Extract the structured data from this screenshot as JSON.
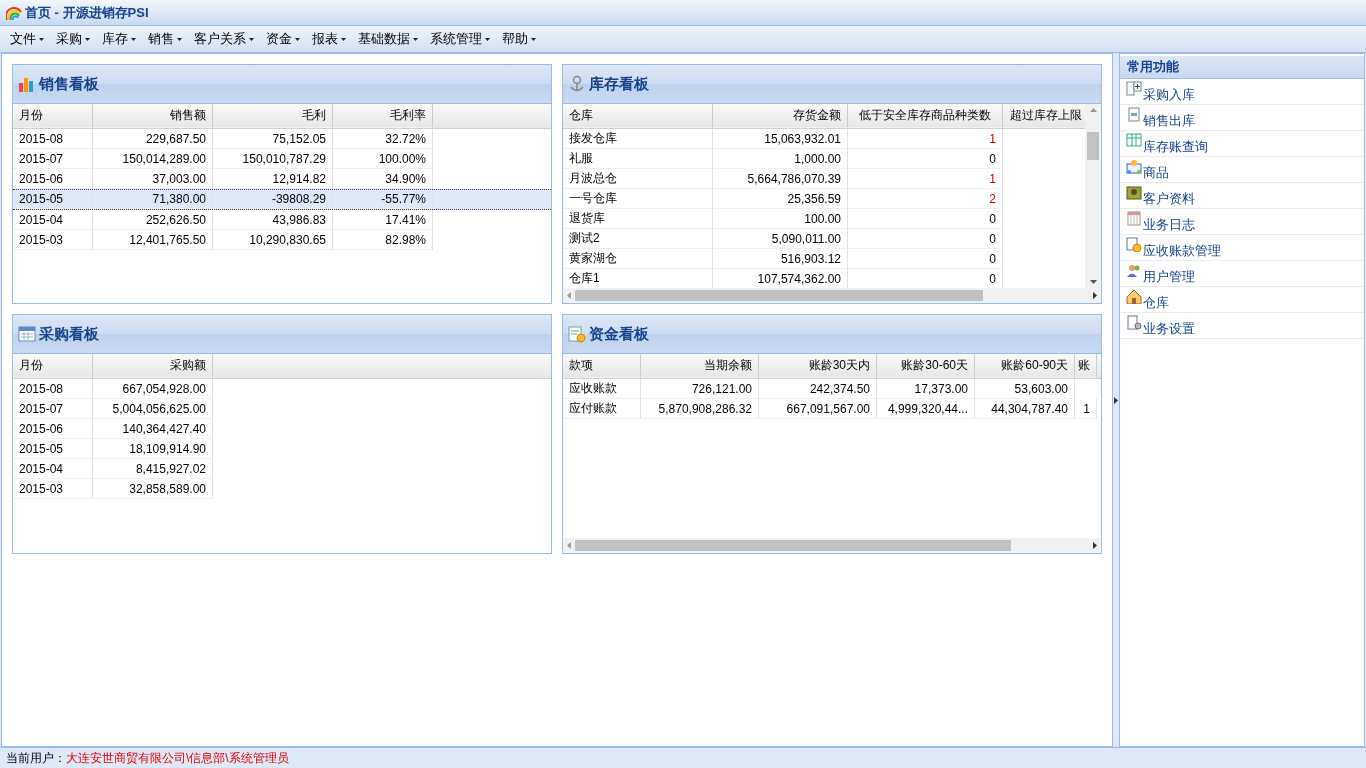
{
  "window": {
    "title": "首页 - 开源进销存PSI"
  },
  "menu": [
    "文件",
    "采购",
    "库存",
    "销售",
    "客户关系",
    "资金",
    "报表",
    "基础数据",
    "系统管理",
    "帮助"
  ],
  "panels": [
    {
      "title": "销售看板",
      "columns": [
        "月份",
        "销售额",
        "毛利",
        "毛利率"
      ],
      "rows": [
        {
          "cells": [
            "2015-08",
            "229,687.50",
            "75,152.05",
            "32.72%"
          ],
          "selected": false
        },
        {
          "cells": [
            "2015-07",
            "150,014,289.00",
            "150,010,787.29",
            "100.00%"
          ],
          "selected": false
        },
        {
          "cells": [
            "2015-06",
            "37,003.00",
            "12,914.82",
            "34.90%"
          ],
          "selected": false
        },
        {
          "cells": [
            "2015-05",
            "71,380.00",
            "-39808.29",
            "-55.77%"
          ],
          "selected": true
        },
        {
          "cells": [
            "2015-04",
            "252,626.50",
            "43,986.83",
            "17.41%"
          ],
          "selected": false
        },
        {
          "cells": [
            "2015-03",
            "12,401,765.50",
            "10,290,830.65",
            "82.98%"
          ],
          "selected": false
        }
      ]
    },
    {
      "title": "库存看板",
      "columns": [
        "仓库",
        "存货金额",
        "低于安全库存商品种类数",
        "超过库存上限"
      ],
      "rows": [
        {
          "cells": [
            "接发仓库",
            "15,063,932.01",
            "1"
          ],
          "warning": true
        },
        {
          "cells": [
            "礼服",
            "1,000.00",
            "0"
          ],
          "warning": false
        },
        {
          "cells": [
            "月波总仓",
            "5,664,786,070.39",
            "1"
          ],
          "warning": true
        },
        {
          "cells": [
            "一号仓库",
            "25,356.59",
            "2"
          ],
          "warning": true
        },
        {
          "cells": [
            "退货库",
            "100.00",
            "0"
          ],
          "warning": false
        },
        {
          "cells": [
            "测试2",
            "5,090,011.00",
            "0"
          ],
          "warning": false
        },
        {
          "cells": [
            "黄家湖仓",
            "516,903.12",
            "0"
          ],
          "warning": false
        },
        {
          "cells": [
            "仓库1",
            "107,574,362.00",
            "0"
          ],
          "warning": false
        }
      ]
    },
    {
      "title": "采购看板",
      "columns": [
        "月份",
        "采购额"
      ],
      "rows": [
        {
          "cells": [
            "2015-08",
            "667,054,928.00"
          ]
        },
        {
          "cells": [
            "2015-07",
            "5,004,056,625.00"
          ]
        },
        {
          "cells": [
            "2015-06",
            "140,364,427.40"
          ]
        },
        {
          "cells": [
            "2015-05",
            "18,109,914.90"
          ]
        },
        {
          "cells": [
            "2015-04",
            "8,415,927.02"
          ]
        },
        {
          "cells": [
            "2015-03",
            "32,858,589.00"
          ]
        }
      ]
    },
    {
      "title": "资金看板",
      "columns": [
        "款项",
        "当期余额",
        "账龄30天内",
        "账龄30-60天",
        "账龄60-90天",
        "账"
      ],
      "rows": [
        {
          "cells": [
            "应收账款",
            "726,121.00",
            "242,374.50",
            "17,373.00",
            "53,603.00"
          ]
        },
        {
          "cells": [
            "应付账款",
            "5,870,908,286.32",
            "667,091,567.00",
            "4,999,320,44...",
            "44,304,787.40",
            "1"
          ]
        }
      ]
    }
  ],
  "sidebar": {
    "title": "常用功能",
    "items": [
      "采购入库",
      "销售出库",
      "库存账查询",
      "商品",
      "客户资料",
      "业务日志",
      "应收账款管理",
      "用户管理",
      "仓库",
      "业务设置"
    ]
  },
  "status_bar": {
    "label": "当前用户：",
    "user": "大连安世商贸有限公司\\信息部\\系统管理员"
  }
}
